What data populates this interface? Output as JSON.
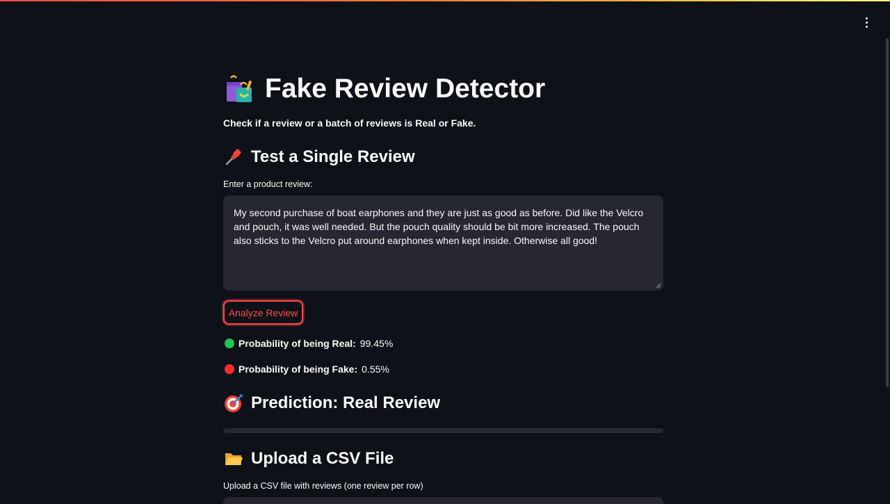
{
  "app": {
    "title": "Fake Review Detector",
    "subtitle": "Check if a review or a batch of reviews is Real or Fake.",
    "title_icon": "shopping-bags-icon",
    "menu_icon": "kebab-menu-icon"
  },
  "single_review": {
    "heading": "Test a Single Review",
    "heading_icon": "pushpin-icon",
    "input_label": "Enter a product review:",
    "input_value": "My second purchase of boat earphones and they are just as good as before. Did like the Velcro and pouch, it was well needed. But the pouch quality should be bit more increased. The pouch also sticks to the Velcro put around earphones when kept inside. Otherwise all good!",
    "button_label": "Analyze Review"
  },
  "results": {
    "real_label": "Probability of being Real:",
    "real_value": "99.45%",
    "real_color": "#21c354",
    "fake_label": "Probability of being Fake:",
    "fake_value": "0.55%",
    "fake_color": "#ff2b2b",
    "prediction_icon": "bullseye-icon",
    "prediction": "Prediction: Real Review"
  },
  "csv_upload": {
    "heading": "Upload a CSV File",
    "heading_icon": "open-folder-icon",
    "label": "Upload a CSV file with reviews (one review per row)"
  },
  "colors": {
    "background": "#0e1117",
    "accent": "#ff4b4b",
    "input_bg": "#262730"
  }
}
